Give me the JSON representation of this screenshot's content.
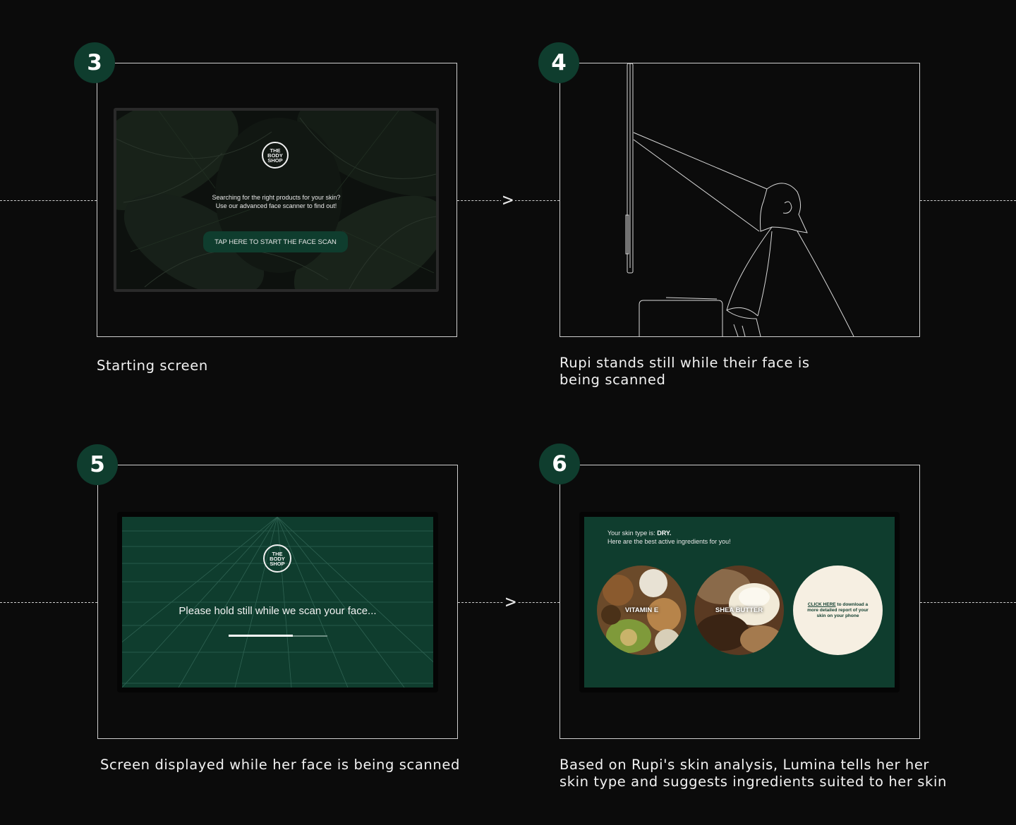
{
  "steps": [
    {
      "number": "3",
      "caption": "Starting screen"
    },
    {
      "number": "4",
      "caption_line1": "Rupi stands still while their face is",
      "caption_line2": "being scanned"
    },
    {
      "number": "5",
      "caption": "Screen displayed while her face is being scanned"
    },
    {
      "number": "6",
      "caption_line1": "Based on Rupi's skin analysis, Lumina tells her her",
      "caption_line2": "skin type and suggests ingredients suited to her skin"
    }
  ],
  "arrow_glyph": ">",
  "brand": {
    "line1": "THE",
    "line2": "BODY",
    "line3": "SHOP"
  },
  "start_screen": {
    "line1": "Searching for the right products for your skin?",
    "line2": "Use our advanced face scanner to find out!",
    "button_label": "TAP HERE TO START THE FACE SCAN"
  },
  "scan_screen": {
    "message": "Please hold still while we scan your face...",
    "progress": 0.65
  },
  "results_screen": {
    "line1_prefix": "Your skin type is: ",
    "skin_type": "DRY.",
    "line2": "Here are the best active ingredients for you!",
    "ingredients": [
      "VITAMIN E",
      "SHEA BUTTER"
    ],
    "cta_link": "CLICK HERE",
    "cta_rest": " to download a more detailed report of your skin on your phone"
  },
  "colors": {
    "accent": "#0f3d2e",
    "background": "#0b0b0b",
    "cta_circle": "#f6efe2"
  }
}
